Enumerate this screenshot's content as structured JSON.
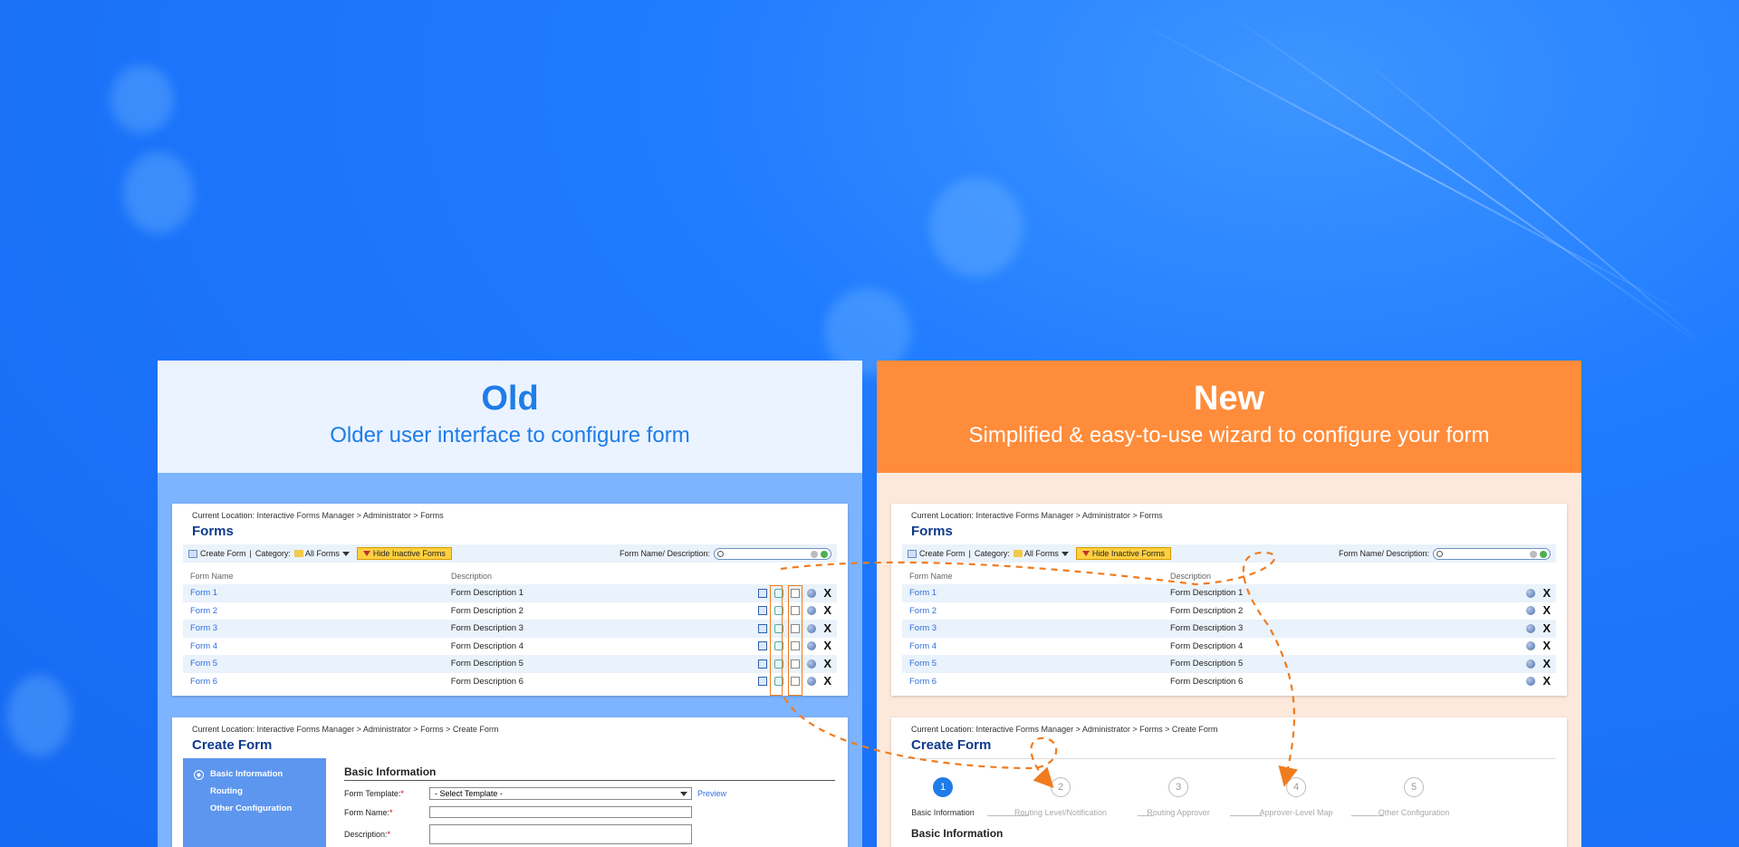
{
  "old": {
    "title": "Old",
    "subtitle": "Older user interface to configure form"
  },
  "new": {
    "title": "New",
    "subtitle": "Simplified & easy-to-use wizard to configure your form"
  },
  "forms_screen": {
    "location": "Current Location: Interactive Forms Manager > Administrator > Forms",
    "title": "Forms",
    "toolbar": {
      "create_form": "Create Form",
      "separator": "|",
      "category_label": "Category:",
      "category_value": "All Forms",
      "hide_inactive": "Hide Inactive Forms",
      "search_label": "Form Name/ Description:"
    },
    "columns": [
      "Form Name",
      "Description"
    ],
    "rows": [
      {
        "name": "Form 1",
        "desc": "Form Description 1"
      },
      {
        "name": "Form 2",
        "desc": "Form Description 2"
      },
      {
        "name": "Form 3",
        "desc": "Form Description 3"
      },
      {
        "name": "Form 4",
        "desc": "Form Description 4"
      },
      {
        "name": "Form 5",
        "desc": "Form Description 5"
      },
      {
        "name": "Form 6",
        "desc": "Form Description 6"
      }
    ]
  },
  "create_screen": {
    "location": "Current Location: Interactive Forms Manager > Administrator > Forms > Create Form",
    "title": "Create Form",
    "nav": [
      "Basic Information",
      "Routing",
      "Other Configuration"
    ],
    "section_title": "Basic Information",
    "form_template_label": "Form Template:",
    "form_template_value": "- Select Template -",
    "preview": "Preview",
    "form_name_label": "Form Name:",
    "description_label": "Description:",
    "required_mark": "*"
  },
  "wizard": {
    "steps": [
      {
        "num": "1",
        "label": "Basic Information"
      },
      {
        "num": "2",
        "label": "Routing Level/Notification"
      },
      {
        "num": "3",
        "label": "Routing Approver"
      },
      {
        "num": "4",
        "label": "Approver-Level Map"
      },
      {
        "num": "5",
        "label": "Other Configuration"
      }
    ],
    "section_title": "Basic Information"
  },
  "colors": {
    "accent_blue": "#1f7ce8",
    "accent_orange": "#ff8c3b",
    "arrow_orange": "#f07c20"
  }
}
